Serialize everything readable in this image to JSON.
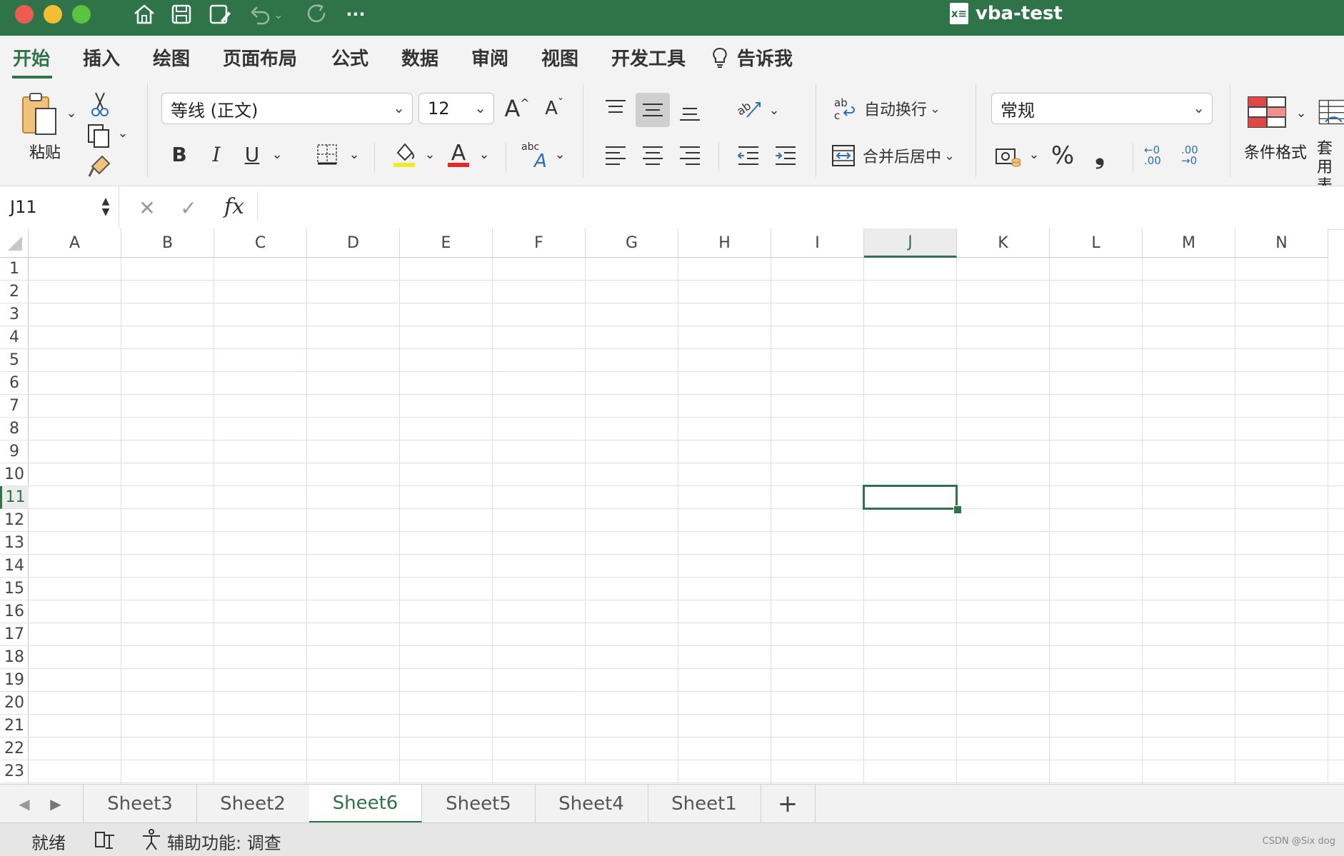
{
  "titlebar": {
    "document_title": "vba-test",
    "doc_badge": "x≡",
    "colors": {
      "bar": "#2f7348",
      "close": "#ee5b53",
      "minimize": "#f5bd31",
      "zoom": "#5ac43e"
    },
    "more_glyph": "···"
  },
  "tabs": [
    "开始",
    "插入",
    "绘图",
    "页面布局",
    "公式",
    "数据",
    "审阅",
    "视图",
    "开发工具"
  ],
  "tell_me": "告诉我",
  "ribbon": {
    "paste_label": "粘贴",
    "font_name": "等线 (正文)",
    "font_size": "12",
    "bold": "B",
    "italic": "I",
    "underline": "U",
    "wrap_text": "自动换行",
    "merge_center": "合并后居中",
    "number_format": "常规",
    "percent": "%",
    "comma": "❟",
    "increase_decimal": "←0 .00",
    "decrease_decimal": ".00 →0",
    "conditional_format": "条件格式",
    "table_format": "套用 表格"
  },
  "formula_bar": {
    "name_box": "J11",
    "cancel": "✕",
    "enter": "✓",
    "fx": "fx",
    "formula": ""
  },
  "sheet": {
    "columns": [
      "A",
      "B",
      "C",
      "D",
      "E",
      "F",
      "G",
      "H",
      "I",
      "J",
      "K",
      "L",
      "M",
      "N"
    ],
    "rows": [
      "1",
      "2",
      "3",
      "4",
      "5",
      "6",
      "7",
      "8",
      "9",
      "10",
      "11",
      "12",
      "13",
      "14",
      "15",
      "16",
      "17",
      "18",
      "19",
      "20",
      "21",
      "22",
      "23"
    ],
    "selected_column": "J",
    "selected_row": "11"
  },
  "sheet_tabs": [
    "Sheet3",
    "Sheet2",
    "Sheet6",
    "Sheet5",
    "Sheet4",
    "Sheet1"
  ],
  "active_sheet": "Sheet6",
  "add_sheet": "+",
  "status": {
    "ready": "就绪",
    "accessibility": "辅助功能: 调查",
    "watermark": "CSDN @Six dog"
  }
}
